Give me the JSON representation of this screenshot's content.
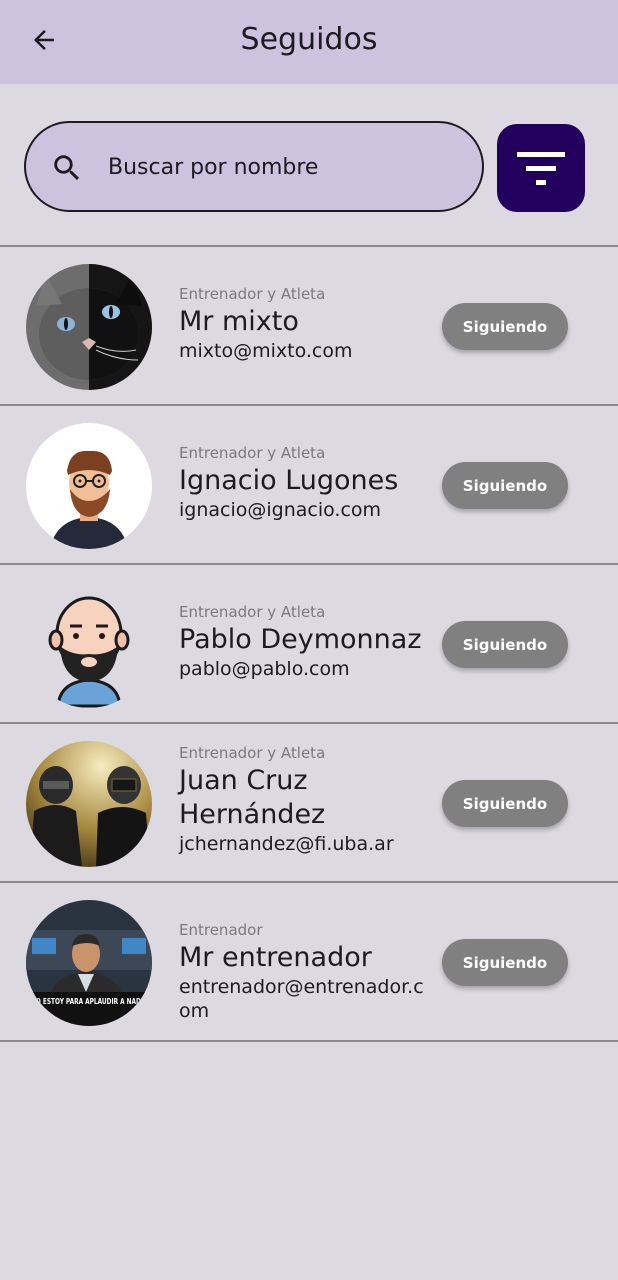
{
  "header": {
    "title": "Seguidos",
    "back_icon": "arrow-back-icon"
  },
  "search": {
    "placeholder": "Buscar por nombre",
    "icon": "search-icon"
  },
  "filter": {
    "icon": "filter-icon",
    "color": "#24005e"
  },
  "users": [
    {
      "role": "Entrenador y Atleta",
      "name": "Mr mixto",
      "email": "mixto@mixto.com",
      "button": "Siguiendo",
      "avatar": "cat-photo"
    },
    {
      "role": "Entrenador y Atleta",
      "name": "Ignacio Lugones",
      "email": "ignacio@ignacio.com",
      "button": "Siguiendo",
      "avatar": "bearded-man-illustration"
    },
    {
      "role": "Entrenador y Atleta",
      "name": "Pablo Deymonnaz",
      "email": "pablo@pablo.com",
      "button": "Siguiendo",
      "avatar": "bald-man-illustration"
    },
    {
      "role": "Entrenador y Atleta",
      "name": "Juan Cruz Hernández",
      "email": "jchernandez@fi.uba.ar",
      "button": "Siguiendo",
      "avatar": "helmet-duo-photo"
    },
    {
      "role": "Entrenador",
      "name": "Mr entrenador",
      "email": "entrenador@entrenador.com",
      "button": "Siguiendo",
      "avatar": "man-in-suit-photo",
      "avatar_caption": "\"NO ESTOY PARA APLAUDIR A NADIE\""
    }
  ],
  "colors": {
    "app_bar": "#cec3df",
    "background": "#ddd9e1",
    "button": "#808080"
  }
}
